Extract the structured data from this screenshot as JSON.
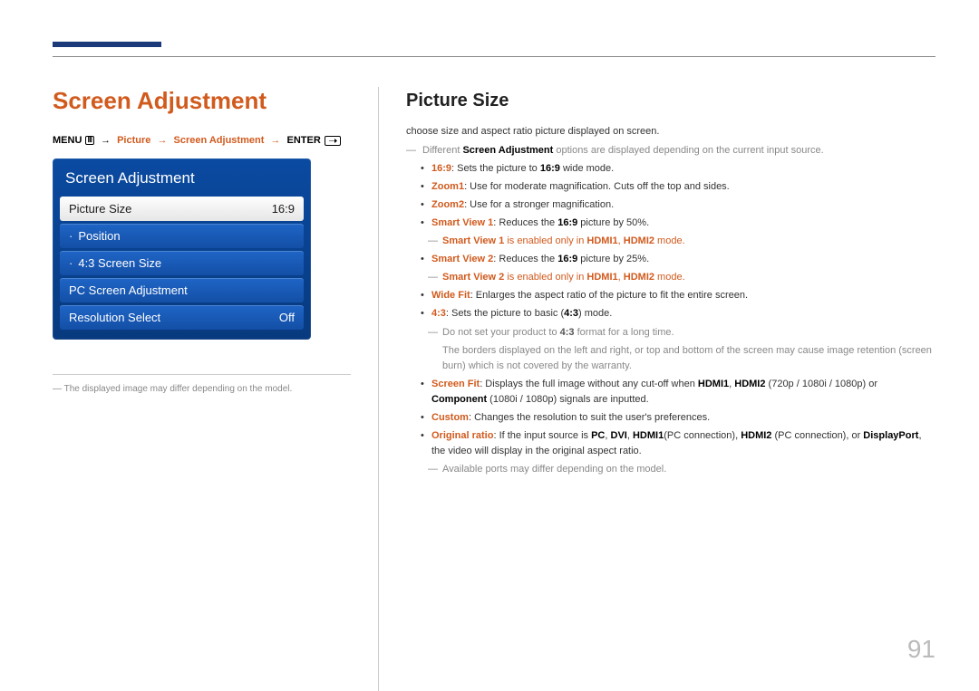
{
  "page_number": "91",
  "left": {
    "heading": "Screen Adjustment",
    "breadcrumb": {
      "menu": "MENU",
      "step1": "Picture",
      "step2": "Screen Adjustment",
      "enter": "ENTER"
    },
    "osd": {
      "title": "Screen Adjustment",
      "rows": [
        {
          "label": "Picture Size",
          "value": "16:9",
          "selected": true,
          "dotted": false
        },
        {
          "label": "Position",
          "value": "",
          "selected": false,
          "dotted": true
        },
        {
          "label": "4:3 Screen Size",
          "value": "",
          "selected": false,
          "dotted": true
        },
        {
          "label": "PC Screen Adjustment",
          "value": "",
          "selected": false,
          "dotted": false
        },
        {
          "label": "Resolution Select",
          "value": "Off",
          "selected": false,
          "dotted": false
        }
      ]
    },
    "footnote": "The displayed image may differ depending on the model."
  },
  "right": {
    "heading": "Picture Size",
    "intro": "choose size and aspect ratio picture displayed on screen.",
    "note_different": {
      "prefix": "Different ",
      "bold": "Screen Adjustment",
      "suffix": " options are displayed depending on the current input source."
    },
    "items": {
      "i169": {
        "term": "16:9",
        "text1": ": Sets the picture to ",
        "term2": "16:9",
        "text2": " wide mode."
      },
      "zoom1": {
        "term": "Zoom1",
        "text": ": Use for moderate magnification. Cuts off the top and sides."
      },
      "zoom2": {
        "term": "Zoom2",
        "text": ": Use for a stronger magnification."
      },
      "sv1": {
        "term": "Smart View 1",
        "t1": ": Reduces the ",
        "b1": "16:9",
        "t2": " picture by 50%."
      },
      "sv1note": {
        "b1": "Smart View 1",
        "t1": " is enabled only in ",
        "b2": "HDMI1",
        "sep": ", ",
        "b3": "HDMI2",
        "t2": " mode."
      },
      "sv2": {
        "term": "Smart View 2",
        "t1": ": Reduces the ",
        "b1": "16:9",
        "t2": " picture by 25%."
      },
      "sv2note": {
        "b1": "Smart View 2",
        "t1": " is enabled only in ",
        "b2": "HDMI1",
        "sep": ", ",
        "b3": "HDMI2",
        "t2": " mode."
      },
      "widefit": {
        "term": "Wide Fit",
        "text": ": Enlarges the aspect ratio of the picture to fit the entire screen."
      },
      "i43": {
        "term": "4:3",
        "t1": ": Sets the picture to basic (",
        "b1": "4:3",
        "t2": ") mode."
      },
      "i43note1": {
        "t1": "Do not set your product to ",
        "b1": "4:3",
        "t2": " format for a long time."
      },
      "i43note2": "The borders displayed on the left and right, or top and bottom of the screen may cause image retention (screen burn) which is not covered by the warranty.",
      "screenfit": {
        "term": "Screen Fit",
        "t1": ": Displays the full image without any cut-off when ",
        "b1": "HDMI1",
        "sep1": ", ",
        "b2": "HDMI2",
        "t2": " (720p / 1080i / 1080p) or ",
        "b3": "Component",
        "t3": " (1080i / 1080p) signals are inputted."
      },
      "custom": {
        "term": "Custom",
        "text": ": Changes the resolution to suit the user's preferences."
      },
      "original": {
        "term": "Original ratio",
        "t1": ": If the input source is ",
        "b1": "PC",
        "s1": ", ",
        "b2": "DVI",
        "s2": ", ",
        "b3": "HDMI1",
        "t2": "(PC connection), ",
        "b4": "HDMI2",
        "t3": " (PC connection), or ",
        "b5": "DisplayPort",
        "t4": ", the video will display in the original aspect ratio."
      },
      "portsnote": "Available ports may differ depending on the model."
    }
  }
}
